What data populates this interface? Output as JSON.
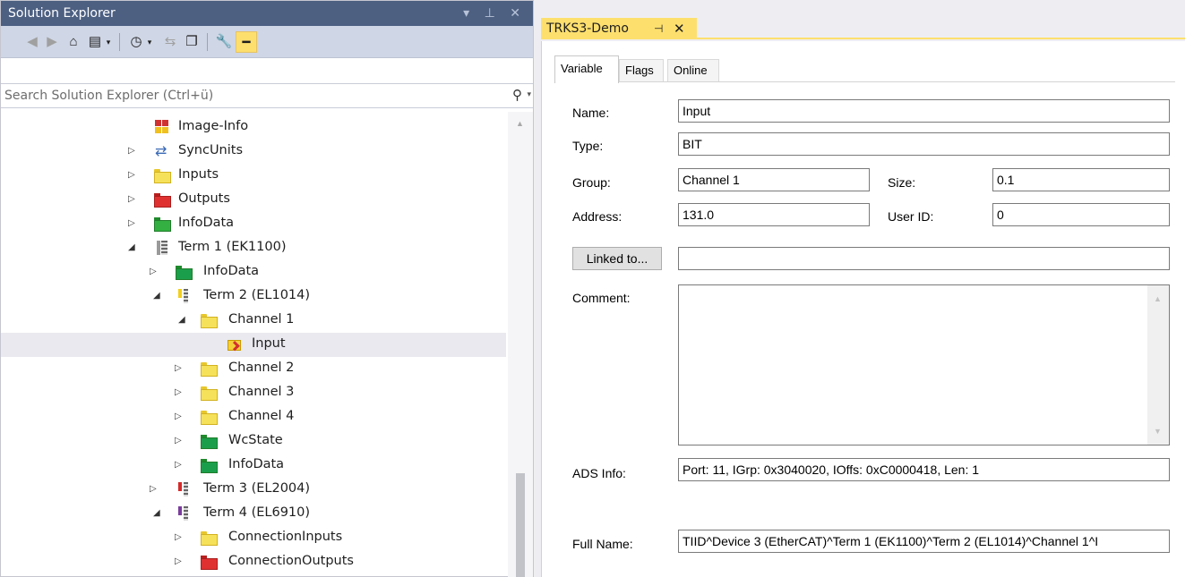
{
  "solution_explorer": {
    "title": "Solution Explorer",
    "title_controls": "▾ ⊥ ✕",
    "search_placeholder": "Search Solution Explorer (Ctrl+ü)",
    "tree": [
      {
        "label": "Image-Info",
        "icon": "image-info-icon"
      },
      {
        "label": "SyncUnits",
        "icon": "sync-units-icon"
      },
      {
        "label": "Inputs",
        "icon": "yellow-folder-icon"
      },
      {
        "label": "Outputs",
        "icon": "red-folder-icon"
      },
      {
        "label": "InfoData",
        "icon": "green-folder-icon"
      },
      {
        "label": "Term 1 (EK1100)",
        "icon": "coupler-terminal-icon"
      },
      {
        "label": "InfoData",
        "icon": "green-folder-icon"
      },
      {
        "label": "Term 2 (EL1014)",
        "icon": "input-terminal-icon"
      },
      {
        "label": "Channel 1",
        "icon": "yellow-folder-icon"
      },
      {
        "label": "Input",
        "icon": "input-variable-icon"
      },
      {
        "label": "Channel 2",
        "icon": "yellow-folder-icon"
      },
      {
        "label": "Channel 3",
        "icon": "yellow-folder-icon"
      },
      {
        "label": "Channel 4",
        "icon": "yellow-folder-icon"
      },
      {
        "label": "WcState",
        "icon": "green-folder-icon"
      },
      {
        "label": "InfoData",
        "icon": "green-folder-icon"
      },
      {
        "label": "Term 3 (EL2004)",
        "icon": "output-terminal-icon"
      },
      {
        "label": "Term 4 (EL6910)",
        "icon": "safety-terminal-icon"
      },
      {
        "label": "ConnectionInputs",
        "icon": "yellow-folder-icon"
      },
      {
        "label": "ConnectionOutputs",
        "icon": "red-folder-icon"
      }
    ]
  },
  "document": {
    "tab_title": "TRKS3-Demo",
    "tabs": [
      "Variable",
      "Flags",
      "Online"
    ],
    "active_tab": "Variable",
    "labels": {
      "name": "Name:",
      "type": "Type:",
      "group": "Group:",
      "size": "Size:",
      "address": "Address:",
      "user_id": "User ID:",
      "linked_to": "Linked to...",
      "comment": "Comment:",
      "ads_info": "ADS Info:",
      "full_name": "Full Name:"
    },
    "values": {
      "name": "Input",
      "type": "BIT",
      "group": "Channel 1",
      "size": "0.1",
      "address": "131.0",
      "user_id": "0",
      "linked_to": "",
      "comment": "",
      "ads_info": "Port: 11, IGrp: 0x3040020, IOffs: 0xC0000418, Len: 1",
      "full_name": "TIID^Device 3 (EtherCAT)^Term 1 (EK1100)^Term 2 (EL1014)^Channel 1^I"
    }
  },
  "colors": {
    "title_bar": "#4d6082",
    "accent_tab": "#fddf6e",
    "toolbar": "#cfd6e5"
  }
}
